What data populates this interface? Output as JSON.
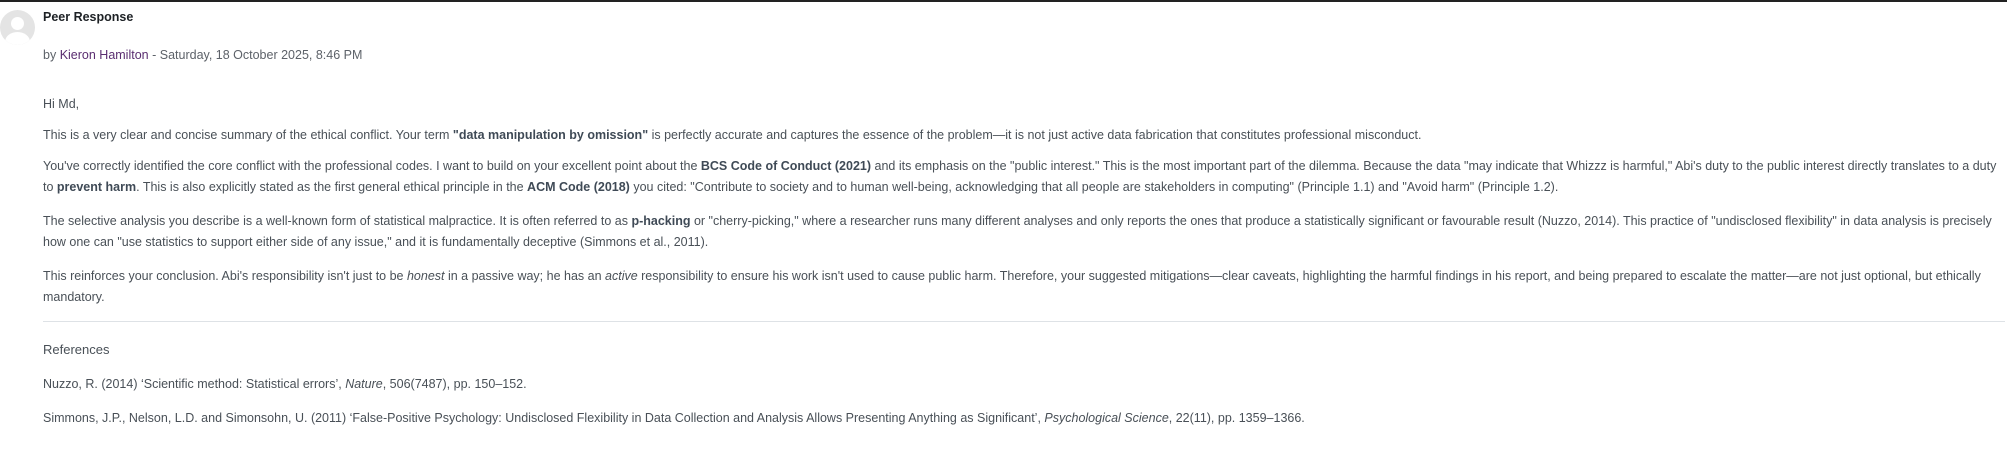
{
  "post": {
    "subject": "Peer Response",
    "by_prefix": "by",
    "author": "Kieron Hamilton",
    "date_sep": " - ",
    "date": "Saturday, 18 October 2025, 8:46 PM"
  },
  "body": {
    "greeting": "Hi Md,",
    "p1": {
      "a": "This is a very clear and concise summary of the ethical conflict. Your term ",
      "b1": "\"data manipulation by omission\"",
      "c": " is perfectly accurate and captures the essence of the problem—it is not just active data fabrication that constitutes professional misconduct."
    },
    "p2": {
      "a": "You've correctly identified the core conflict with the professional codes. I want to build on your excellent point about the ",
      "b1": "BCS Code of Conduct (2021)",
      "c": " and its emphasis on the \"public interest.\" This is the most important part of the dilemma. Because the data \"may indicate that Whizzz is harmful,\" Abi's duty to the public interest directly translates to a duty to ",
      "b2": "prevent harm",
      "d": ". This is also explicitly stated as the first general ethical principle in the ",
      "b3": "ACM Code (2018)",
      "e": " you cited: \"Contribute to society and to human well-being, acknowledging that all people are stakeholders in computing\" (Principle 1.1) and \"Avoid harm\" (Principle 1.2)."
    },
    "p3": {
      "a": "The selective analysis you describe is a well-known form of statistical malpractice. It is often referred to as ",
      "b1": "p-hacking",
      "c": " or \"cherry-picking,\" where a researcher runs many different analyses and only reports the ones that produce a statistically significant or favourable result (Nuzzo, 2014). This practice of \"undisclosed flexibility\" in data analysis is precisely how one can \"use statistics to support either side of any issue,\" and it is fundamentally deceptive (Simmons et al., 2011)."
    },
    "p4": {
      "a": "This reinforces your conclusion. Abi's responsibility isn't just to be ",
      "i1": "honest",
      "c": " in a passive way; he has an ",
      "i2": "active",
      "d": " responsibility to ensure his work isn't used to cause public harm. Therefore, your suggested mitigations—clear caveats, highlighting the harmful findings in his report, and being prepared to escalate the matter—are not just optional, but ethically mandatory."
    }
  },
  "references": {
    "title": "References",
    "r1": {
      "a": "Nuzzo, R. (2014) ‘Scientific method: Statistical errors’, ",
      "i": "Nature",
      "c": ", 506(7487), pp. 150–152."
    },
    "r2": {
      "a": "Simmons, J.P., Nelson, L.D. and Simonsohn, U. (2011) ‘False-Positive Psychology: Undisclosed Flexibility in Data Collection and Analysis Allows Presenting Anything as Significant’, ",
      "i": "Psychological Science",
      "c": ", 22(11), pp. 1359–1366."
    }
  }
}
